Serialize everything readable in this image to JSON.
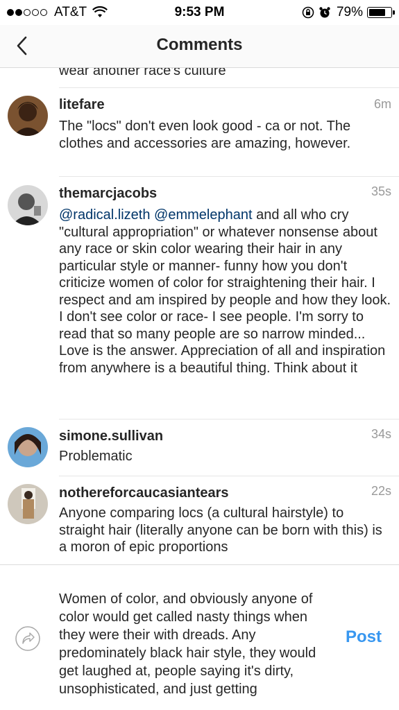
{
  "status_bar": {
    "carrier": "AT&T",
    "time": "9:53 PM",
    "battery": "79%",
    "battery_level": 0.79
  },
  "nav": {
    "title": "Comments"
  },
  "truncated_comment_tail": "wear another race's culture",
  "comments": [
    {
      "username": "litefare",
      "time": "6m",
      "text": "The \"locs\" don't even look good - ca or not. The clothes and accessories are amazing, however."
    },
    {
      "username": "themarcjacobs",
      "time": "35s",
      "mention1": "@radical.lizeth",
      "mention2": "@emmelephant",
      "text": " and all who cry \"cultural appropriation\" or whatever nonsense about any race or skin color wearing their hair in any particular style or manner- funny how you don't criticize women of color for straightening their hair. I respect and am inspired by people and how they look.  I don't see color or race- I see people. I'm sorry to read that so many people are so narrow minded... Love is the answer. Appreciation of all and inspiration from anywhere is a beautiful thing. Think about it"
    },
    {
      "username": "simone.sullivan",
      "time": "34s",
      "text": "Problematic"
    },
    {
      "username": "nothereforcaucasiantears",
      "time": "22s",
      "text": "Anyone comparing locs (a cultural hairstyle) to straight hair (literally anyone can be born with this) is a moron of epic proportions"
    }
  ],
  "composer": {
    "text": "Women of color, and obviously anyone of color would get called nasty things when they were their with dreads. Any predominately black hair style, they would get laughed at, people saying it's dirty, unsophisticated, and just getting",
    "post_label": "Post",
    "share_icon": "share-icon"
  }
}
